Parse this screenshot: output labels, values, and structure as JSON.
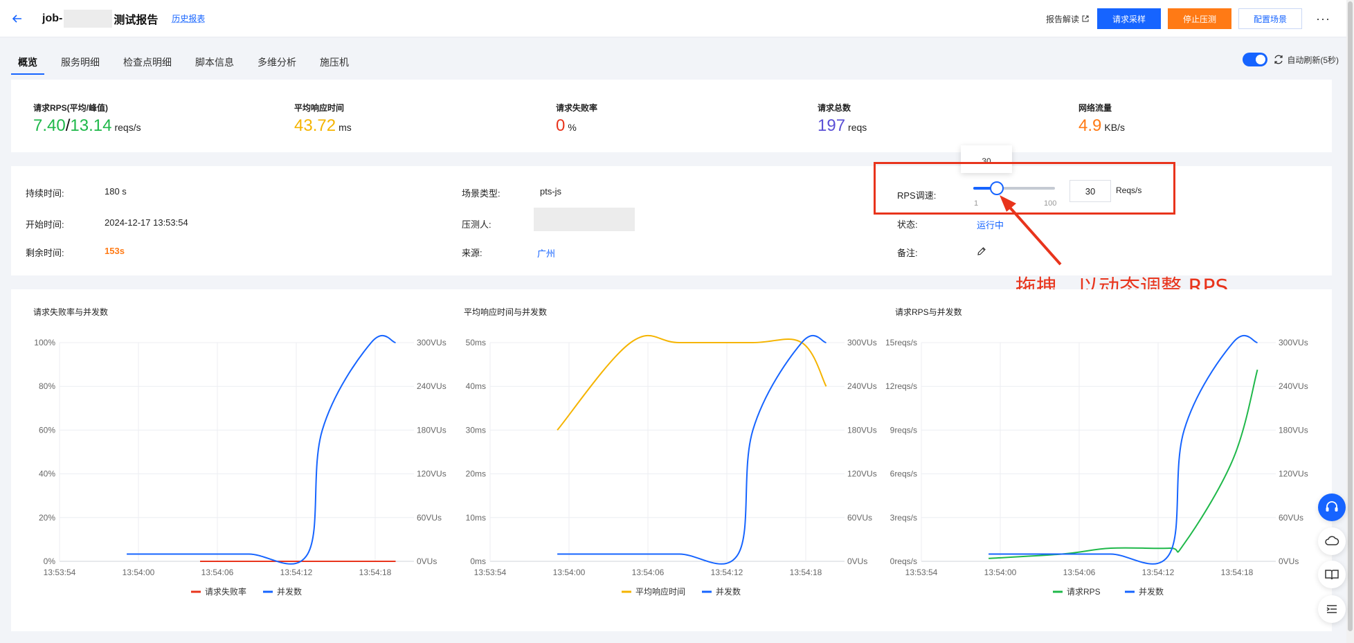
{
  "header": {
    "job_prefix": "job-",
    "job_suffix": "测试报告",
    "history_link": "历史报表",
    "report_read": "报告解读",
    "request_sample": "请求采样",
    "stop_test": "停止压测",
    "config_scene": "配置场景",
    "more": "···"
  },
  "tabs": [
    "概览",
    "服务明细",
    "检查点明细",
    "脚本信息",
    "多维分析",
    "施压机"
  ],
  "auto_refresh": {
    "label": "自动刷新(5秒)",
    "enabled": true
  },
  "metrics": {
    "rps": {
      "label": "请求RPS(平均/峰值)",
      "avg": "7.40",
      "sep": "/",
      "peak": "13.14",
      "unit": "reqs/s",
      "color": "#1fb84a"
    },
    "latency": {
      "label": "平均响应时间",
      "value": "43.72",
      "unit": "ms",
      "color": "#f5b400"
    },
    "fail": {
      "label": "请求失败率",
      "value": "0",
      "unit": "%",
      "color": "#e8341c"
    },
    "total": {
      "label": "请求总数",
      "value": "197",
      "unit": "reqs",
      "color": "#5a4fd6"
    },
    "traffic": {
      "label": "网络流量",
      "value": "4.9",
      "unit": "KB/s",
      "color": "#ff7a15"
    }
  },
  "info": {
    "duration_label": "持续时间:",
    "duration_value": "180 s",
    "start_label": "开始时间:",
    "start_value": "2024-12-17 13:53:54",
    "remain_label": "剩余时间:",
    "remain_value": "153s",
    "scene_label": "场景类型:",
    "scene_value": "pts-js",
    "tester_label": "压测人:",
    "source_label": "来源:",
    "source_value": "广州",
    "rps_label": "RPS调速:",
    "rps_min": "1",
    "rps_max": "100",
    "rps_value": "30",
    "rps_unit": "Reqs/s",
    "rps_tooltip": "30",
    "rps_fraction": 0.29,
    "status_label": "状态:",
    "status_value": "运行中",
    "note_label": "备注:"
  },
  "annotation": "拖拽，以动态调整 RPS",
  "chart_data": [
    {
      "type": "line",
      "title": "请求失败率与并发数",
      "x_ticks": [
        "13:53:54",
        "13:54:00",
        "13:54:06",
        "13:54:12",
        "13:54:18"
      ],
      "left_ticks": [
        "100%",
        "80%",
        "60%",
        "40%",
        "20%",
        "0%"
      ],
      "right_ticks": [
        "300VUs",
        "240VUs",
        "180VUs",
        "120VUs",
        "60VUs",
        "0VUs"
      ],
      "left_range": [
        0,
        100
      ],
      "right_range": [
        0,
        300
      ],
      "series": [
        {
          "name": "请求失败率",
          "axis": "left",
          "color": "#e8341c",
          "x": [
            13.53,
            13.54,
            13.55,
            13.56,
            13.57,
            13.58,
            13.59,
            13.6,
            13.61
          ],
          "values": [
            0,
            0,
            0,
            0,
            0,
            0,
            0,
            0,
            0
          ]
        },
        {
          "name": "并发数",
          "axis": "right",
          "color": "#1664ff",
          "x": [
            13.5,
            13.53,
            13.55,
            13.574,
            13.58,
            13.6,
            13.61
          ],
          "values": [
            10,
            10,
            10,
            10,
            180,
            300,
            300
          ]
        }
      ]
    },
    {
      "type": "line",
      "title": "平均响应时间与并发数",
      "x_ticks": [
        "13:53:54",
        "13:54:00",
        "13:54:06",
        "13:54:12",
        "13:54:18"
      ],
      "left_ticks": [
        "50ms",
        "40ms",
        "30ms",
        "20ms",
        "10ms",
        "0ms"
      ],
      "right_ticks": [
        "300VUs",
        "240VUs",
        "180VUs",
        "120VUs",
        "60VUs",
        "0VUs"
      ],
      "left_range": [
        0,
        50
      ],
      "right_range": [
        0,
        300
      ],
      "series": [
        {
          "name": "平均响应时间",
          "axis": "left",
          "color": "#f5b400",
          "x": [
            13.5,
            13.53,
            13.55,
            13.58,
            13.6,
            13.61
          ],
          "values": [
            30,
            50,
            50,
            50,
            50,
            40
          ]
        },
        {
          "name": "并发数",
          "axis": "right",
          "color": "#1664ff",
          "x": [
            13.5,
            13.53,
            13.55,
            13.574,
            13.58,
            13.6,
            13.61
          ],
          "values": [
            10,
            10,
            10,
            10,
            180,
            300,
            300
          ]
        }
      ]
    },
    {
      "type": "line",
      "title": "请求RPS与并发数",
      "x_ticks": [
        "13:53:54",
        "13:54:00",
        "13:54:06",
        "13:54:12",
        "13:54:18"
      ],
      "left_ticks": [
        "15reqs/s",
        "12reqs/s",
        "9reqs/s",
        "6reqs/s",
        "3reqs/s",
        "0reqs/s"
      ],
      "right_ticks": [
        "300VUs",
        "240VUs",
        "180VUs",
        "120VUs",
        "60VUs",
        "0VUs"
      ],
      "left_range": [
        0,
        15
      ],
      "right_range": [
        0,
        300
      ],
      "series": [
        {
          "name": "请求RPS",
          "axis": "left",
          "color": "#1fb84a",
          "x": [
            13.5,
            13.53,
            13.55,
            13.574,
            13.58,
            13.6,
            13.61
          ],
          "values": [
            0.2,
            0.5,
            0.9,
            0.9,
            1.2,
            7.0,
            13.14
          ]
        },
        {
          "name": "并发数",
          "axis": "right",
          "color": "#1664ff",
          "x": [
            13.5,
            13.53,
            13.55,
            13.574,
            13.58,
            13.6,
            13.61
          ],
          "values": [
            10,
            10,
            10,
            10,
            180,
            300,
            300
          ]
        }
      ]
    }
  ]
}
